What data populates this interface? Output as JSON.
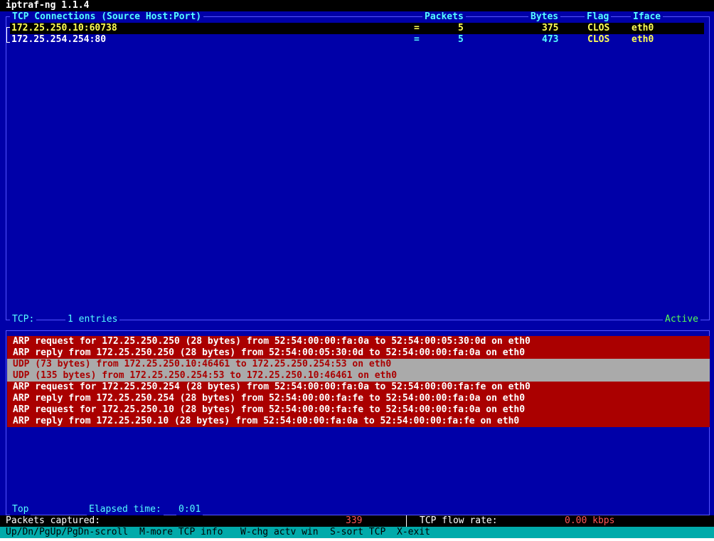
{
  "app": {
    "title": "iptraf-ng 1.1.4"
  },
  "tcp_panel": {
    "title": "TCP Connections (Source Host:Port)",
    "col_packets": "Packets",
    "col_bytes": "Bytes",
    "col_flag": "Flag",
    "col_iface": "Iface",
    "rows": [
      {
        "host": "172.25.250.10:60738",
        "eq": "=",
        "packets": "5",
        "bytes": "375",
        "flag": "CLOS",
        "iface": "eth0"
      },
      {
        "host": "172.25.254.254:80",
        "eq": "=",
        "packets": "5",
        "bytes": "473",
        "flag": "CLOS",
        "iface": "eth0"
      }
    ],
    "footer_label": "TCP:",
    "footer_entries": "1 entries",
    "footer_status": "Active"
  },
  "log_panel": {
    "rows": [
      {
        "text": "ARP request for 172.25.250.250 (28 bytes) from 52:54:00:00:fa:0a to 52:54:00:05:30:0d on eth0",
        "kind": "arp"
      },
      {
        "text": "ARP reply from 172.25.250.250 (28 bytes) from 52:54:00:05:30:0d to 52:54:00:00:fa:0a on eth0",
        "kind": "arp"
      },
      {
        "text": "UDP (73 bytes) from 172.25.250.10:46461 to 172.25.250.254:53 on eth0",
        "kind": "udp"
      },
      {
        "text": "UDP (135 bytes) from 172.25.250.254:53 to 172.25.250.10:46461 on eth0",
        "kind": "udp"
      },
      {
        "text": "ARP request for 172.25.250.254 (28 bytes) from 52:54:00:00:fa:0a to 52:54:00:00:fa:fe on eth0",
        "kind": "arp"
      },
      {
        "text": "ARP reply from 172.25.250.254 (28 bytes) from 52:54:00:00:fa:fe to 52:54:00:00:fa:0a on eth0",
        "kind": "arp"
      },
      {
        "text": "ARP request for 172.25.250.10 (28 bytes) from 52:54:00:00:fa:fe to 52:54:00:00:fa:0a on eth0",
        "kind": "arp"
      },
      {
        "text": "ARP reply from 172.25.250.10 (28 bytes) from 52:54:00:00:fa:0a to 52:54:00:00:fa:fe on eth0",
        "kind": "arp"
      }
    ],
    "footer_pos": "Top",
    "elapsed_label": "Elapsed time:",
    "elapsed_value": "0:01"
  },
  "status": {
    "packets_label": "Packets captured:",
    "packets_value": "339",
    "flow_label": "TCP flow rate:",
    "flow_value": "0.00 kbps"
  },
  "help": {
    "scroll": "Up/Dn/PgUp/PgDn-scroll",
    "more": "M-more TCP info",
    "chg": "W-chg actv win",
    "sort": "S-sort TCP",
    "exit": "X-exit"
  }
}
